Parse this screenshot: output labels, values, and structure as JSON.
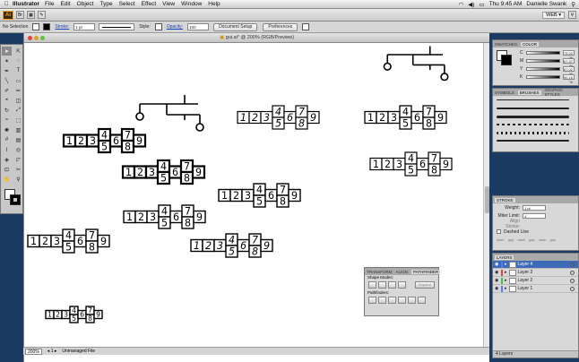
{
  "menubar": {
    "app_name": "Illustrator",
    "items": [
      "File",
      "Edit",
      "Object",
      "Type",
      "Select",
      "Effect",
      "View",
      "Window",
      "Help"
    ],
    "clock": "Thu 9:45 AM",
    "user": "Danielle Swank"
  },
  "appbar": {
    "logo": "Ai",
    "workspace": "WEB ▾"
  },
  "control_bar": {
    "selection": "No Selection",
    "stroke_label": "Stroke:",
    "stroke_value": "1 pt",
    "style_label": "Style:",
    "opacity_label": "Opacity:",
    "opacity_value": "100",
    "document_setup": "Document Setup",
    "preferences": "Preferences"
  },
  "document": {
    "title": "gui.ai* @ 200% (RGB/Preview)",
    "zoom": "200%",
    "status": "Unmanaged File"
  },
  "colors": {
    "accent_selection": "#3e6bb8",
    "logo_orange": "#f7a21b",
    "desktop_blue": "#1c3b63"
  },
  "digit_groups": {
    "digits": [
      "1",
      "2",
      "3",
      "4",
      "5",
      "6",
      "7",
      "8",
      "9"
    ]
  },
  "color_panel": {
    "tabs": [
      "SWATCHES",
      "COLOR"
    ],
    "channels": [
      {
        "name": "C",
        "value": "75.02 %"
      },
      {
        "name": "M",
        "value": "67.97 %"
      },
      {
        "name": "Y",
        "value": "67.02 %"
      },
      {
        "name": "K",
        "value": "90.16 %"
      }
    ]
  },
  "brushes_panel": {
    "tabs": [
      "SYMBOLS",
      "BRUSHES",
      "GRAPHIC STYLES"
    ]
  },
  "stroke_panel": {
    "title": "STROKE",
    "weight_label": "Weight:",
    "weight_value": "1 pt",
    "miter_label": "Miter Limit:",
    "miter_value": "4",
    "align_label": "Align Stroke:",
    "dashed_label": "Dashed Line",
    "dash_labels": [
      "dash",
      "gap",
      "dash",
      "gap",
      "dash",
      "gap"
    ]
  },
  "layers_panel": {
    "title": "LAYERS",
    "layers": [
      {
        "name": "Layer 4",
        "color": "#4f7fff"
      },
      {
        "name": "Layer 3",
        "color": "#e04040"
      },
      {
        "name": "Layer 2",
        "color": "#40c040"
      },
      {
        "name": "Layer 1",
        "color": "#4f7fff"
      }
    ],
    "footer": "4 Layers"
  },
  "pathfinder_panel": {
    "tabs": [
      "TRANSFORM",
      "ALIGN",
      "PATHFINDER"
    ],
    "shape_modes_label": "Shape Modes:",
    "pathfinders_label": "Pathfinders:",
    "expand_label": "Expand"
  }
}
